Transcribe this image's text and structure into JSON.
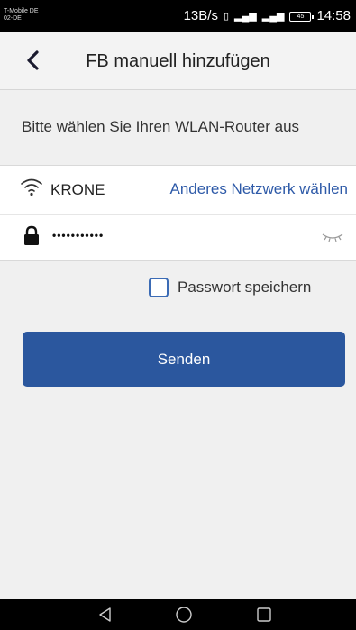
{
  "status_bar": {
    "carrier_line1": "T-Mobile DE",
    "carrier_line2": "02-DE",
    "speed": "13B/s",
    "battery": "45",
    "time": "14:58"
  },
  "header": {
    "title": "FB manuell hinzufügen"
  },
  "main": {
    "prompt": "Bitte wählen Sie Ihren WLAN-Router aus",
    "network": {
      "ssid": "KRONE",
      "other_network_link": "Anderes Netzwerk wählen"
    },
    "password": {
      "masked_value": "•••••••••••"
    },
    "save_password": {
      "label": "Passwort speichern",
      "checked": false
    },
    "send_button": "Senden"
  },
  "colors": {
    "accent": "#2b579e",
    "link": "#2e5aa8",
    "background": "#f0f0f0"
  },
  "icons": [
    "back-chevron-icon",
    "wifi-icon",
    "lock-icon",
    "eye-closed-icon",
    "nav-back-icon",
    "nav-home-icon",
    "nav-recent-icon"
  ]
}
